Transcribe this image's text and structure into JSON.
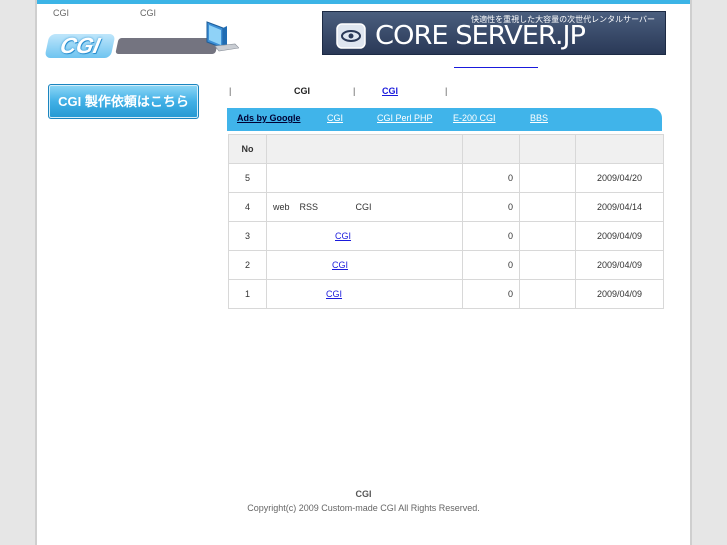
{
  "header": {
    "tag_left": "CGI",
    "tag_right": "CGI",
    "logo_text": "CGI"
  },
  "banner": {
    "title": "CORE SERVER.JP",
    "tagline": "快適性を重視した大容量の次世代レンタルサーバー"
  },
  "sidebar": {
    "order_button": "CGI 製作依頼はこちら"
  },
  "nav": {
    "sep": "|",
    "current": "CGI",
    "link": "CGI"
  },
  "adbar": {
    "ads_by": "Ads by Google",
    "links": [
      "CGI",
      "CGI Perl PHP",
      "E-200 CGI",
      "BBS"
    ]
  },
  "table": {
    "header_no": "No",
    "rows": [
      {
        "no": "5",
        "title": "",
        "count": "0",
        "date": "2009/04/20",
        "is_link": false
      },
      {
        "no": "4",
        "title": "web    RSS               CGI",
        "count": "0",
        "date": "2009/04/14",
        "is_link": false
      },
      {
        "no": "3",
        "title": "CGI",
        "count": "0",
        "date": "2009/04/09",
        "is_link": true
      },
      {
        "no": "2",
        "title": "CGI",
        "count": "0",
        "date": "2009/04/09",
        "is_link": true
      },
      {
        "no": "1",
        "title": "CGI",
        "count": "0",
        "date": "2009/04/09",
        "is_link": true
      }
    ]
  },
  "footer": {
    "title": "CGI",
    "copyright": "Copyright(c) 2009 Custom-made CGI All Rights Reserved."
  },
  "colors": {
    "accent": "#40b4ea",
    "link": "#1a1adc",
    "banner_bg": "#2a3957"
  }
}
